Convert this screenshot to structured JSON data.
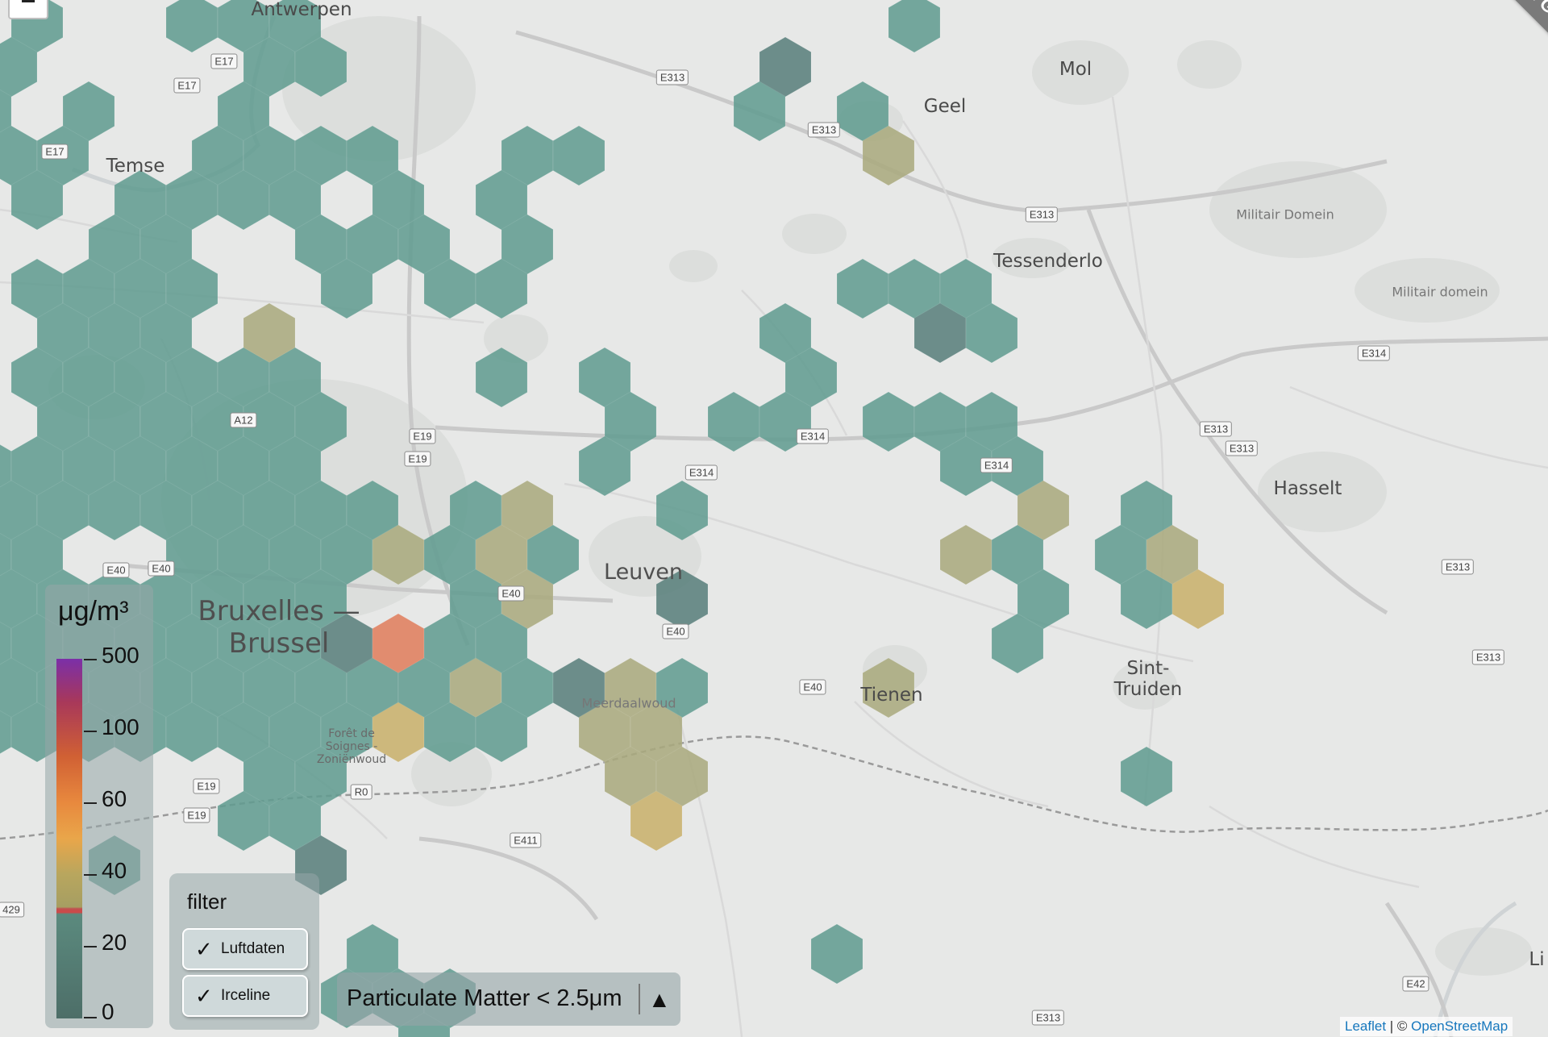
{
  "map": {
    "zoom_out_label": "−",
    "github_ribbon": "Fork me on GitHub",
    "places": [
      "Antwerpen",
      "Mol",
      "Geel",
      "Temse",
      "Militair Domein",
      "Tessenderlo",
      "Militair domein",
      "Hasselt",
      "Leuven",
      "Bruxelles — Brussel",
      "Tienen",
      "Sint-Truiden",
      "Meerdaalwoud",
      "Forêt de Soignes - Zoniënwoud",
      "Li"
    ],
    "road_labels": [
      "E17",
      "E17",
      "E17",
      "E313",
      "E313",
      "E313",
      "E314",
      "E314",
      "E314",
      "E314",
      "E313",
      "E313",
      "E313",
      "E313",
      "E313",
      "A12",
      "E19",
      "E19",
      "E19",
      "E19",
      "E40",
      "E40",
      "E40",
      "E40",
      "E40",
      "E411",
      "E42",
      "R0",
      "429"
    ],
    "colors": {
      "low": "#5f9b8f",
      "dark": "#577e7a",
      "yellow_green": "#a9a97d",
      "yellow": "#c8b06a",
      "orange": "#e07d5b"
    }
  },
  "legend": {
    "unit": "μg/m³",
    "ticks": [
      "500",
      "100",
      "60",
      "40",
      "20",
      "0"
    ]
  },
  "filter": {
    "title": "filter",
    "options": [
      {
        "check": "✓",
        "label": "Luftdaten"
      },
      {
        "check": "✓",
        "label": "Irceline"
      }
    ]
  },
  "pollutant": {
    "label": "Particulate Matter < 2.5μm",
    "toggle_icon": "▲"
  },
  "attribution": {
    "leaflet": "Leaflet",
    "separator": " | © ",
    "osm": "OpenStreetMap"
  }
}
